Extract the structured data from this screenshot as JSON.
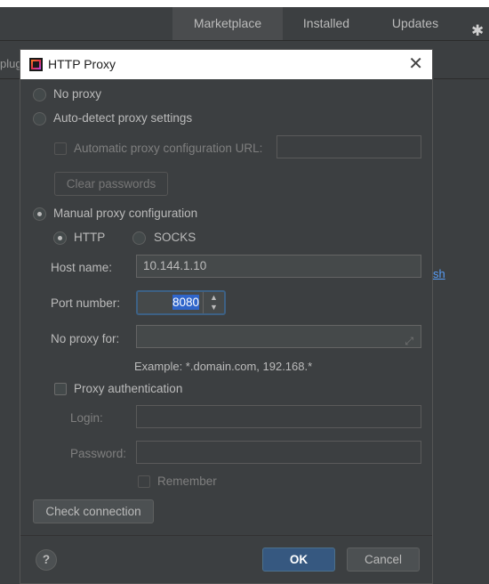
{
  "background": {
    "tabs": [
      "Marketplace",
      "Installed",
      "Updates"
    ],
    "left_label": "plug",
    "right_link": "sh"
  },
  "dialog": {
    "title": "HTTP Proxy",
    "no_proxy": "No proxy",
    "auto_detect": "Auto-detect proxy settings",
    "auto_config_url": "Automatic proxy configuration URL:",
    "clear_passwords": "Clear passwords",
    "manual": "Manual proxy configuration",
    "http": "HTTP",
    "socks": "SOCKS",
    "host_label": "Host name:",
    "host_value": "10.144.1.10",
    "port_label": "Port number:",
    "port_value": "8080",
    "no_proxy_for_label": "No proxy for:",
    "no_proxy_for_value": "",
    "example": "Example: *.domain.com, 192.168.*",
    "proxy_auth": "Proxy authentication",
    "login_label": "Login:",
    "login_value": "",
    "password_label": "Password:",
    "password_value": "",
    "remember": "Remember",
    "check_connection": "Check connection",
    "help": "?",
    "ok": "OK",
    "cancel": "Cancel"
  },
  "icons": [
    "close-icon",
    "gear-icon",
    "app-icon",
    "expand-icon",
    "spinner-arrows-icon",
    "help-icon"
  ],
  "colors": {
    "background": "#3c3f41",
    "accent": "#365880",
    "focus": "#3d6185",
    "selection": "#2f65ca",
    "link": "#589df6"
  }
}
